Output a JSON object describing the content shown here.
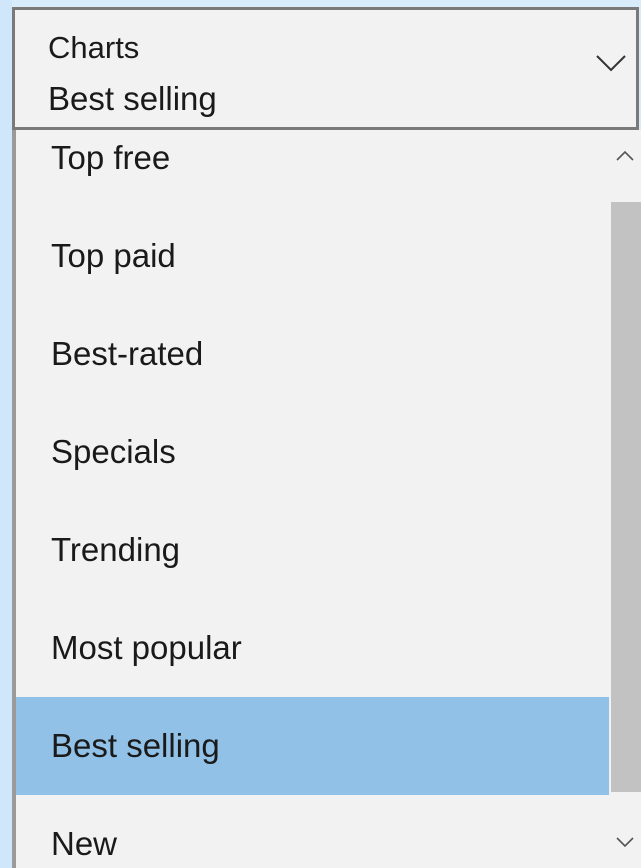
{
  "combo": {
    "label": "Charts",
    "value": "Best selling",
    "chevron_icon": "chevron-down-icon"
  },
  "dropdown": {
    "items": [
      {
        "label": "Top free",
        "selected": false
      },
      {
        "label": "Top paid",
        "selected": false
      },
      {
        "label": "Best-rated",
        "selected": false
      },
      {
        "label": "Specials",
        "selected": false
      },
      {
        "label": "Trending",
        "selected": false
      },
      {
        "label": "Most popular",
        "selected": false
      },
      {
        "label": "Best selling",
        "selected": true
      },
      {
        "label": "New",
        "selected": false
      }
    ],
    "scrollbar": {
      "up_icon": "chevron-up-icon",
      "down_icon": "chevron-down-icon"
    }
  },
  "colors": {
    "selected_bg": "#91c1e7",
    "list_bg": "#f2f2f2",
    "border": "#7a7a7a"
  }
}
